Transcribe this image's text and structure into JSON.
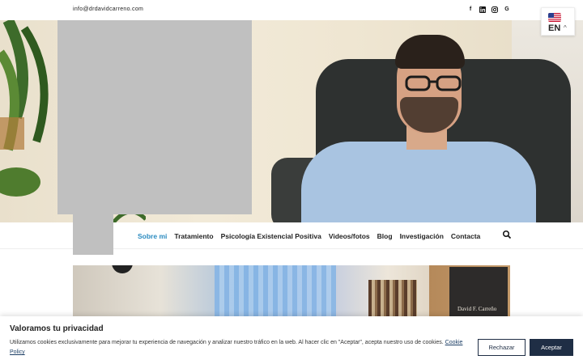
{
  "topbar": {
    "email": "info@drdavidcarreno.com",
    "social": [
      {
        "icon": "facebook-icon",
        "glyph": "f"
      },
      {
        "icon": "linkedin-icon",
        "glyph": "in"
      },
      {
        "icon": "instagram-icon",
        "glyph": "◎"
      },
      {
        "icon": "google-icon",
        "glyph": "G"
      }
    ]
  },
  "language": {
    "code": "EN",
    "flag_icon": "us-flag-icon",
    "caret": "^"
  },
  "nav": {
    "items": [
      {
        "label": "Sobre mi",
        "active": true
      },
      {
        "label": "Tratamiento",
        "active": false
      },
      {
        "label": "Psicología Existencial Positiva",
        "active": false
      },
      {
        "label": "Videos/fotos",
        "active": false
      },
      {
        "label": "Blog",
        "active": false
      },
      {
        "label": "Investigación",
        "active": false
      },
      {
        "label": "Contacta",
        "active": false
      }
    ],
    "search_icon": "search-icon",
    "active_color": "#2b8bc0"
  },
  "office": {
    "sign_text": "David F. Carreño"
  },
  "cookie": {
    "title": "Valoramos tu privacidad",
    "message": "Utilizamos cookies exclusivamente para mejorar tu experiencia de navegación y analizar nuestro tráfico en la web. Al hacer clic en \"Aceptar\", acepta nuestro uso de cookies.",
    "policy_link": "Cookie Policy",
    "reject_label": "Rechazar",
    "accept_label": "Aceptar",
    "accent": "#1f2e45"
  }
}
